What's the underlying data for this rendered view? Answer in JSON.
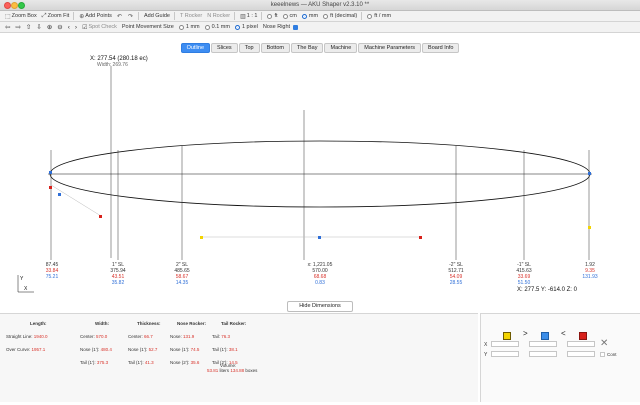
{
  "window": {
    "title": "keeelnews — AKU Shaper v2.3.10 **"
  },
  "toolbar1": {
    "zoom_box": "Zoom Box",
    "zoom_fit": "Zoom Fit",
    "add_points": "Add Points",
    "add_guide": "Add Guide",
    "t_rocker": "T Rocker",
    "n_rocker": "N Rocker",
    "scale": "1 : 1",
    "units": [
      "ft",
      "cm",
      "mm",
      "ft (decimal)",
      "ft / mm"
    ],
    "selected_unit": "mm"
  },
  "toolbar2": {
    "nav_glyphs": [
      "⇦",
      "⇨",
      "⇧",
      "⇩",
      "⊕",
      "⊖",
      "‹",
      "›"
    ],
    "spot_check": "Spot Check",
    "point_movement_label": "Point Movement Size",
    "movement_options": [
      "1 mm",
      "0.1 mm",
      "1 pixel"
    ],
    "selected_movement": "1 pixel",
    "nose_right": "Nose Right"
  },
  "tabs": [
    "Outline",
    "Slices",
    "Top",
    "Bottom",
    "The Bay",
    "Machine",
    "Machine Parameters",
    "Board Info"
  ],
  "active_tab": "Outline",
  "cursor": {
    "x_readout": "X: 277.54 (280.18 ec)",
    "width_readout": "Width: 269.76"
  },
  "stations": [
    {
      "name": "",
      "dist": "87.45",
      "red": "33.84",
      "blue": "75.21"
    },
    {
      "name": "1\" SL",
      "dist": "375.94",
      "red": "43.51",
      "blue": "35.82"
    },
    {
      "name": "2\" SL",
      "dist": "485.65",
      "red": "58.67",
      "blue": "14.35"
    },
    {
      "name": "x: 1,221.05",
      "dist": "570.00",
      "red": "68.68",
      "blue": "0.83"
    },
    {
      "name": "-2\" SL",
      "dist": "512.71",
      "red": "54.09",
      "blue": "28.55"
    },
    {
      "name": "-1\" SL",
      "dist": "415.63",
      "red": "33.69",
      "blue": "51.50"
    },
    {
      "name": "",
      "dist": "1.92",
      "red": "9.35",
      "blue": "131.93"
    }
  ],
  "axis": {
    "x": "X",
    "y": "Y"
  },
  "coords": "X: 277.5  Y: -614.0  Z: 0",
  "hide_dimensions": "Hide Dimensions",
  "dimensions": {
    "length": {
      "header": "Length:",
      "rows": [
        {
          "k": "Straight Line:",
          "v": "1940.0"
        },
        {
          "k": "Over Curve:",
          "v": "1957.1"
        }
      ]
    },
    "width": {
      "header": "Width:",
      "rows": [
        {
          "k": "Center:",
          "v": "570.0"
        },
        {
          "k": "Nose (1'):",
          "v": "480.4"
        },
        {
          "k": "Tail (1'):",
          "v": "375.3"
        }
      ]
    },
    "thickness": {
      "header": "Thickness:",
      "rows": [
        {
          "k": "Center:",
          "v": "66.7"
        },
        {
          "k": "Nose (1'):",
          "v": "52.7"
        },
        {
          "k": "Tail (1'):",
          "v": "41.3"
        }
      ]
    },
    "nose_rocker": {
      "header": "Nose Rocker:",
      "rows": [
        {
          "k": "Nose:",
          "v": "131.9"
        },
        {
          "k": "Nose (1'):",
          "v": "74.5"
        },
        {
          "k": "Nose (2'):",
          "v": "35.6"
        }
      ]
    },
    "tail_rocker": {
      "header": "Tail Rocker:",
      "rows": [
        {
          "k": "Tail:",
          "v": "76.3"
        },
        {
          "k": "Tail (1'):",
          "v": "38.1"
        },
        {
          "k": "Tail (2'):",
          "v": "14.5"
        }
      ]
    },
    "volume": {
      "label": "Volume:",
      "litres": "53.81",
      "litres_unit": "liters",
      "boxes": "134.88",
      "boxes_unit": "boxes"
    }
  },
  "right_panel": {
    "colors": {
      "yellow": "#f3d400",
      "blue": "#3b8de8",
      "red": "#d8211b"
    },
    "x_label": "X",
    "y_label": "Y",
    "cont_label": "Cont",
    "arrow_right": ">",
    "arrow_left": "<",
    "delete_glyph": "✕"
  }
}
